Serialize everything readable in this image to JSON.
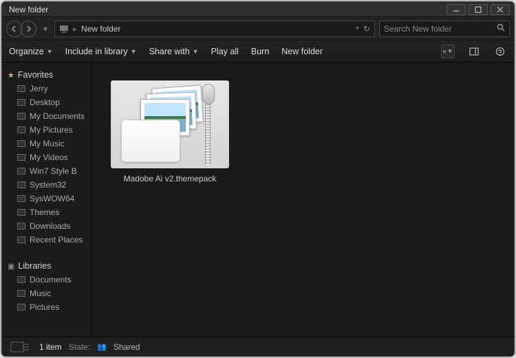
{
  "window": {
    "title": "New folder"
  },
  "address": {
    "crumbs": [
      "New folder"
    ],
    "refresh_symbol": "↻"
  },
  "search": {
    "placeholder": "Search New folder"
  },
  "toolbar": {
    "organize": "Organize",
    "include": "Include in library",
    "share": "Share with",
    "play_all": "Play all",
    "burn": "Burn",
    "new_folder": "New folder"
  },
  "sidebar": {
    "favorites_label": "Favorites",
    "favorites": [
      "Jerry",
      "Desktop",
      "My Documents",
      "My Pictures",
      "My Music",
      "My Videos",
      "Win7 Style B",
      "System32",
      "SysWOW64",
      "Themes",
      "Downloads",
      "Recent Places"
    ],
    "libraries_label": "Libraries",
    "libraries": [
      "Documents",
      "Music",
      "Pictures"
    ]
  },
  "files": [
    {
      "name": "Madobe Ai v2.themepack"
    }
  ],
  "status": {
    "count_text": "1 item",
    "state_label": "State:",
    "state_value": "Shared"
  }
}
